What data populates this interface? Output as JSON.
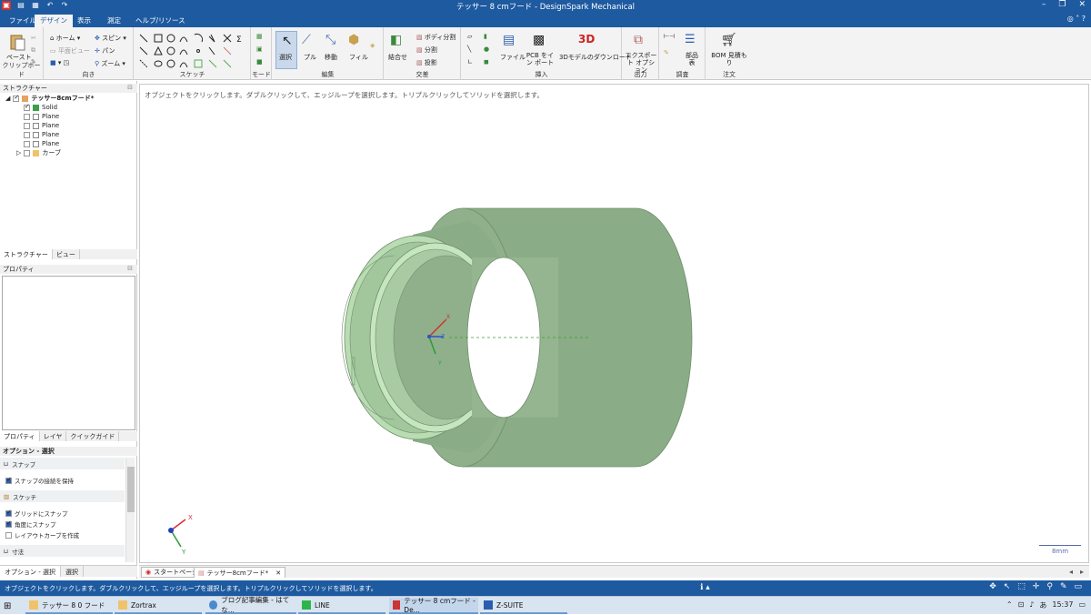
{
  "window": {
    "title": "テッサー 8 cmフード - DesignSpark Mechanical"
  },
  "menu": {
    "tabs": [
      "ファイル",
      "デザイン",
      "表示",
      "測定",
      "ヘルプ/リソース"
    ],
    "active": "デザイン"
  },
  "ribbon": {
    "clipboard": {
      "paste": "ペースト",
      "label": "クリップボード"
    },
    "orient": {
      "home": "ホーム",
      "plane_view": "平面ビュー",
      "spin": "スピン",
      "pan": "パン",
      "zoom": "ズーム",
      "label": "向き"
    },
    "sketch": {
      "label": "スケッチ"
    },
    "mode": {
      "label": "モード"
    },
    "edit": {
      "select": "選択",
      "pull": "プル",
      "move": "移動",
      "fill": "フィル",
      "label": "編集"
    },
    "intersect": {
      "combine": "結合せ",
      "split_body": "ボディ分割",
      "split": "分割",
      "project": "投影",
      "label": "交差"
    },
    "insert": {
      "file": "ファイル",
      "pcb": "PCB をイン ポート",
      "download3d": "3Dモデルのダウンロード",
      "label": "挿入"
    },
    "output": {
      "export": "エクスポート オプション",
      "label": "出力"
    },
    "investigate": {
      "parts_table": "部品 表",
      "label": "調査"
    },
    "order": {
      "bom": "BOM 見積もり",
      "label": "注文"
    }
  },
  "structure": {
    "header": "ストラクチャー",
    "root": "テッサー8cmフード*",
    "items": [
      "Solid",
      "Plane",
      "Plane",
      "Plane",
      "Plane",
      "カーブ"
    ],
    "tabs": [
      "ストラクチャー",
      "ビュー"
    ]
  },
  "properties": {
    "header": "プロパティ",
    "tabs": [
      "プロパティ",
      "レイヤ",
      "クイックガイド"
    ]
  },
  "options": {
    "header": "オプション - 選択",
    "groups": [
      {
        "title": "スナップ",
        "items": [
          {
            "label": "スナップの接続を保持",
            "checked": true
          }
        ]
      },
      {
        "title": "スケッチ",
        "items": [
          {
            "label": "グリッドにスナップ",
            "checked": true
          },
          {
            "label": "角度にスナップ",
            "checked": true
          },
          {
            "label": "レイアウトカーブを作成",
            "checked": false
          }
        ]
      },
      {
        "title": "寸法",
        "items": []
      }
    ]
  },
  "bottom_tabs": [
    "オプション - 選択",
    "選択"
  ],
  "viewport": {
    "hint": "オブジェクトをクリックします。ダブルクリックして、エッジループを選択します。トリプルクリックしてソリッドを選択します。",
    "scale_label": "8mm",
    "axes": {
      "x": "X",
      "y": "Y",
      "z": "Z"
    },
    "model_color": "#8fae8a"
  },
  "doc_tabs": [
    "スタートページ",
    "テッサー8cmフード*"
  ],
  "status": {
    "text": "オブジェクトをクリックします。ダブルクリックして、エッジループを選択します。トリプルクリックしてソリッドを選択します。",
    "info": "ℹ"
  },
  "taskbar": {
    "items": [
      "テッサー 8 0 フード",
      "Zortrax",
      "ブログ記事編集 - はてな...",
      "LINE",
      "テッサー 8 cmフード - De...",
      "Z-SUITE"
    ],
    "time": "15:37",
    "ime": "あ"
  }
}
